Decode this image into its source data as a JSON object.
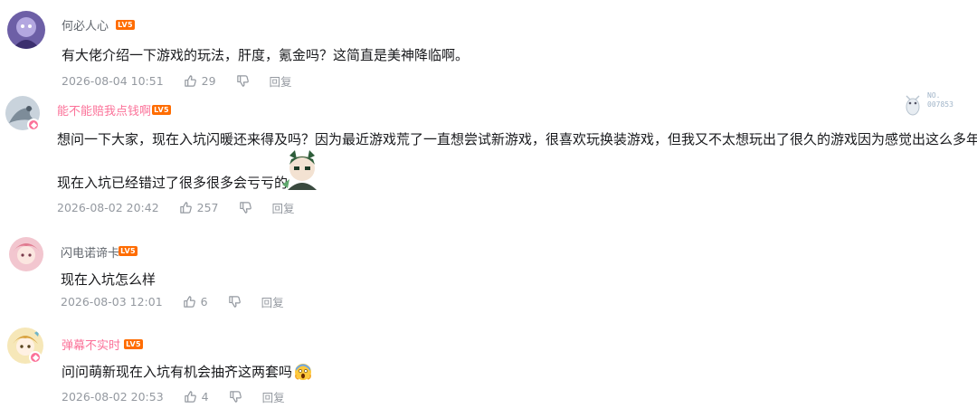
{
  "comments": [
    {
      "username": "何必人心",
      "level": "LV5",
      "text": "有大佬介绍一下游戏的玩法，肝度，氪金吗？这简直是美神降临啊。",
      "time": "2026-08-04 10:51",
      "likes": "29",
      "reply_label": "回复"
    },
    {
      "username": "能不能赔我点钱啊",
      "level": "LV5",
      "text_line1": "想问一下大家，现在入坑闪暖还来得及吗？因为最近游戏荒了一直想尝试新游戏，很喜欢玩换装游戏，但我又不太想玩出了很久的游戏因为感觉出这么多年了",
      "text_line2": "现在入坑已经错过了很多很多会亏亏的",
      "time": "2026-08-02 20:42",
      "likes": "257",
      "reply_label": "回复",
      "fan_badge": {
        "no_label": "NO.",
        "number": "007853"
      }
    },
    {
      "username": "闪电诺谛卡",
      "level": "LV5",
      "text": "现在入坑怎么样",
      "time": "2026-08-03 12:01",
      "likes": "6",
      "reply_label": "回复"
    },
    {
      "username": "弹幕不实时",
      "level": "LV5",
      "text": "问问萌新现在入坑有机会抽齐这两套吗",
      "time": "2026-08-02 20:53",
      "likes": "4",
      "reply_label": "回复"
    }
  ],
  "icons": {
    "like": "thumbs-up-icon",
    "dislike": "thumbs-down-icon",
    "vip": "vip-badge-icon",
    "emoji_scream": "face-screaming-emoji"
  },
  "colors": {
    "pink_username": "#fb7299",
    "level_badge": "#ff6c00",
    "meta_text": "#9499a0"
  }
}
